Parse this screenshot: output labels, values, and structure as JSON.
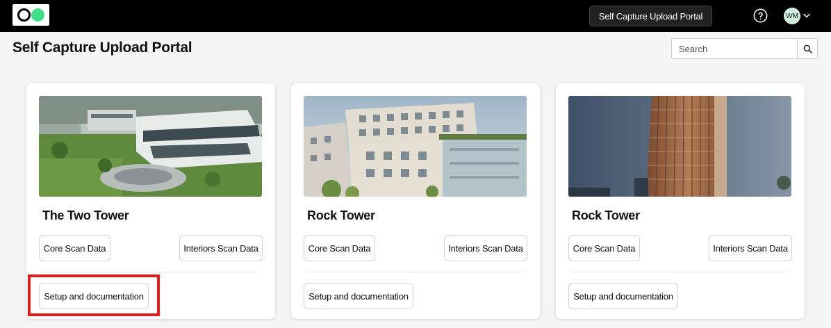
{
  "topbar": {
    "portal_button": "Self Capture Upload Portal",
    "user_initials": "WM"
  },
  "page": {
    "title": "Self Capture Upload Portal"
  },
  "search": {
    "placeholder": "Search"
  },
  "projects": [
    {
      "name": "The Two Tower",
      "core_label": "Core Scan Data",
      "interiors_label": "Interiors Scan Data",
      "setup_label": "Setup and documentation"
    },
    {
      "name": "Rock Tower",
      "core_label": "Core Scan Data",
      "interiors_label": "Interiors Scan Data",
      "setup_label": "Setup and documentation"
    },
    {
      "name": "Rock Tower",
      "core_label": "Core Scan Data",
      "interiors_label": "Interiors Scan Data",
      "setup_label": "Setup and documentation"
    }
  ],
  "colors": {
    "topbar": "#000000",
    "logo_accent": "#3ee08a",
    "highlight": "#e11d1d",
    "avatar": "#cfeee0"
  },
  "icons": {
    "help": "help-icon",
    "search": "search-icon",
    "chevron": "chevron-down-icon"
  }
}
